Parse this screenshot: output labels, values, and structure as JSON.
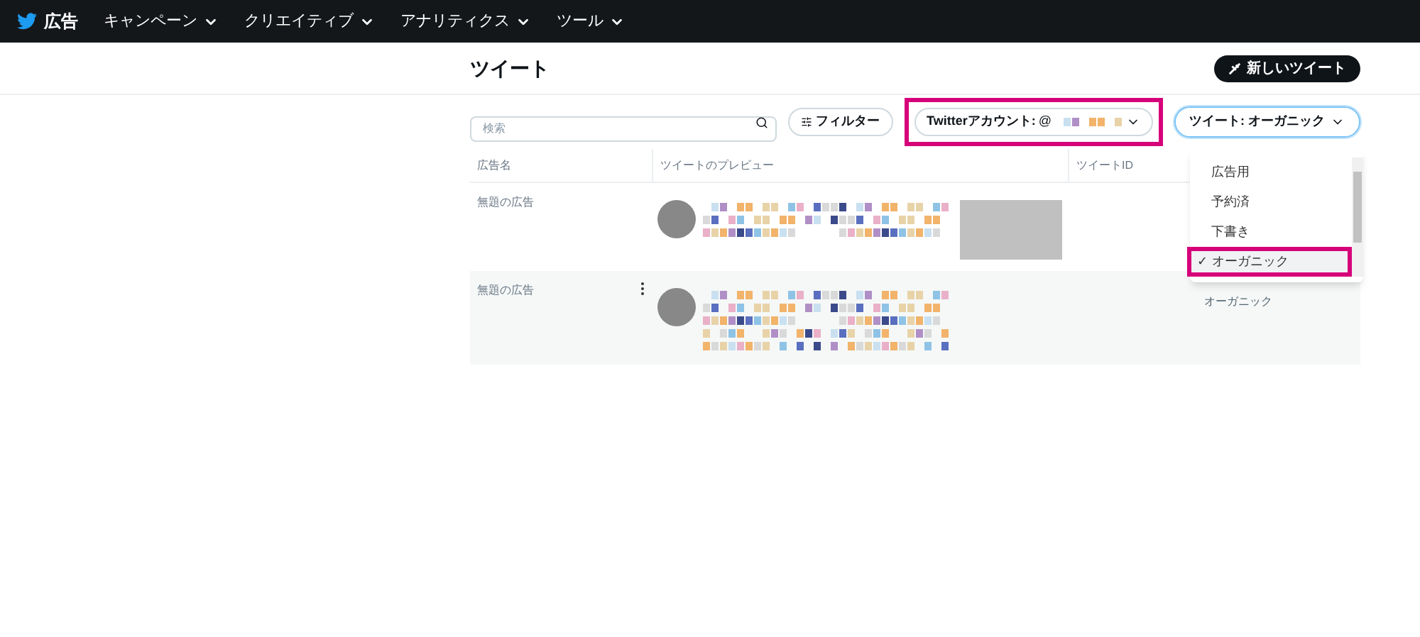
{
  "nav": {
    "brand": "広告",
    "items": [
      {
        "label": "キャンペーン"
      },
      {
        "label": "クリエイティブ"
      },
      {
        "label": "アナリティクス"
      },
      {
        "label": "ツール"
      }
    ]
  },
  "page": {
    "title": "ツイート",
    "new_button": "新しいツイート"
  },
  "toolbar": {
    "search": {
      "placeholder": "検索"
    },
    "filter_button": "フィルター",
    "account_filter": {
      "label": "Twitterアカウント:",
      "handle": "@",
      "highlighted": true
    },
    "type_filter": {
      "label": "ツイート: オーガニック",
      "expanded": true
    }
  },
  "type_options": [
    {
      "label": "広告用",
      "selected": false,
      "highlighted": false
    },
    {
      "label": "予約済",
      "selected": false,
      "highlighted": false
    },
    {
      "label": "下書き",
      "selected": false,
      "highlighted": false
    },
    {
      "label": "✓ オーガニック",
      "selected": true,
      "highlighted": true
    }
  ],
  "table": {
    "columns": [
      "広告名",
      "ツイートのプレビュー",
      "ツイートID"
    ],
    "rows": [
      {
        "name": "無題の広告",
        "has_media": true,
        "hovered": false
      },
      {
        "name": "無題の広告",
        "type": "オーガニック",
        "has_media": false,
        "hovered": true
      }
    ]
  }
}
